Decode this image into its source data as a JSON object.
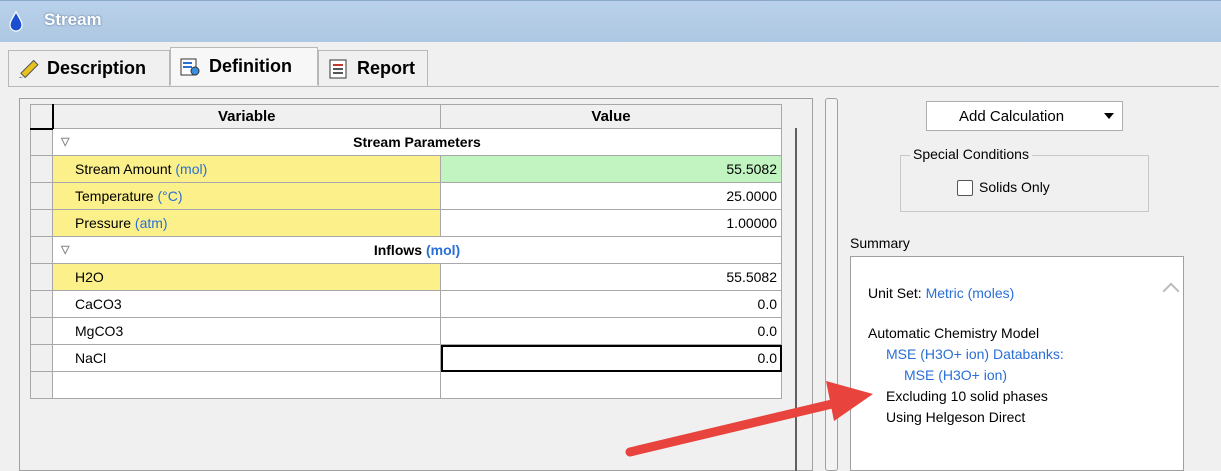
{
  "window": {
    "title": "Stream"
  },
  "tabs": [
    {
      "label": "Description"
    },
    {
      "label": "Definition"
    },
    {
      "label": "Report"
    }
  ],
  "grid": {
    "headers": {
      "variable": "Variable",
      "value": "Value"
    },
    "sections": {
      "stream_parameters": "Stream Parameters",
      "inflows": "Inflows",
      "inflows_unit": "(mol)"
    },
    "rows": [
      {
        "name": "Stream Amount",
        "unit": "(mol)",
        "value": "55.5082"
      },
      {
        "name": "Temperature",
        "unit": "(°C)",
        "value": "25.0000"
      },
      {
        "name": "Pressure",
        "unit": "(atm)",
        "value": "1.00000"
      },
      {
        "name": "H2O",
        "value": "55.5082"
      },
      {
        "name": "CaCO3",
        "value": "0.0"
      },
      {
        "name": "MgCO3",
        "value": "0.0"
      },
      {
        "name": "NaCl",
        "value": "0.0"
      }
    ]
  },
  "side": {
    "add_calc_label": "Add Calculation",
    "special_conditions": "Special Conditions",
    "solids_only": "Solids Only",
    "summary_label": "Summary"
  },
  "summary": {
    "unit_set_label": "Unit Set:",
    "unit_set_value": "Metric (moles)",
    "model": "Automatic Chemistry Model",
    "databanks": "MSE (H3O+ ion) Databanks:",
    "databank_item": "MSE (H3O+ ion)",
    "excluding": "Excluding 10 solid phases",
    "helgeson": "Using Helgeson Direct"
  },
  "colors": {
    "titlebar": "#aec7e2",
    "highlight_yellow": "#fbf08a",
    "highlight_green": "#c2f4c2",
    "link_blue": "#2a6fd6",
    "arrow_red": "#e8433c"
  }
}
